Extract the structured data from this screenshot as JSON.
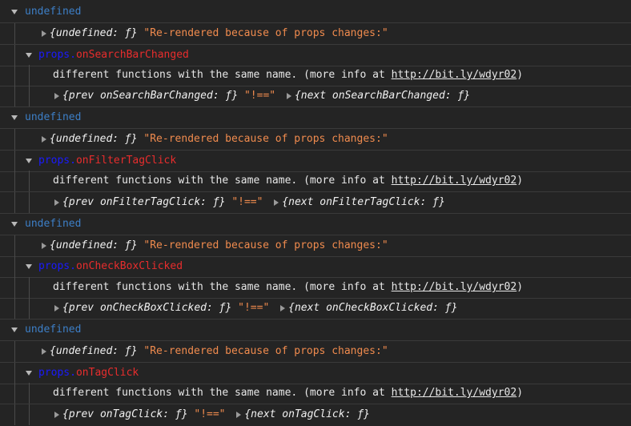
{
  "groups": [
    {
      "header": "undefined",
      "summary": {
        "object": "{undefined: ƒ}",
        "message": "\"Re-rendered because of props changes:\""
      },
      "props_prefix": "props.",
      "props_key": "onSearchBarChanged",
      "detail_text": "different functions with the same name. (more info at ",
      "detail_link": "http://bit.ly/wdyr02",
      "detail_close": ")",
      "prev": "{prev onSearchBarChanged: ƒ}",
      "neq": "\"!==\"",
      "next": "{next onSearchBarChanged: ƒ}"
    },
    {
      "header": "undefined",
      "summary": {
        "object": "{undefined: ƒ}",
        "message": "\"Re-rendered because of props changes:\""
      },
      "props_prefix": "props.",
      "props_key": "onFilterTagClick",
      "detail_text": "different functions with the same name. (more info at ",
      "detail_link": "http://bit.ly/wdyr02",
      "detail_close": ")",
      "prev": "{prev onFilterTagClick: ƒ}",
      "neq": "\"!==\"",
      "next": "{next onFilterTagClick: ƒ}"
    },
    {
      "header": "undefined",
      "summary": {
        "object": "{undefined: ƒ}",
        "message": "\"Re-rendered because of props changes:\""
      },
      "props_prefix": "props.",
      "props_key": "onCheckBoxClicked",
      "detail_text": "different functions with the same name. (more info at ",
      "detail_link": "http://bit.ly/wdyr02",
      "detail_close": ")",
      "prev": "{prev onCheckBoxClicked: ƒ}",
      "neq": "\"!==\"",
      "next": "{next onCheckBoxClicked: ƒ}"
    },
    {
      "header": "undefined",
      "summary": {
        "object": "{undefined: ƒ}",
        "message": "\"Re-rendered because of props changes:\""
      },
      "props_prefix": "props.",
      "props_key": "onTagClick",
      "detail_text": "different functions with the same name. (more info at ",
      "detail_link": "http://bit.ly/wdyr02",
      "detail_close": ")",
      "prev": "{prev onTagClick: ƒ}",
      "neq": "\"!==\"",
      "next": "{next onTagClick: ƒ}"
    }
  ]
}
